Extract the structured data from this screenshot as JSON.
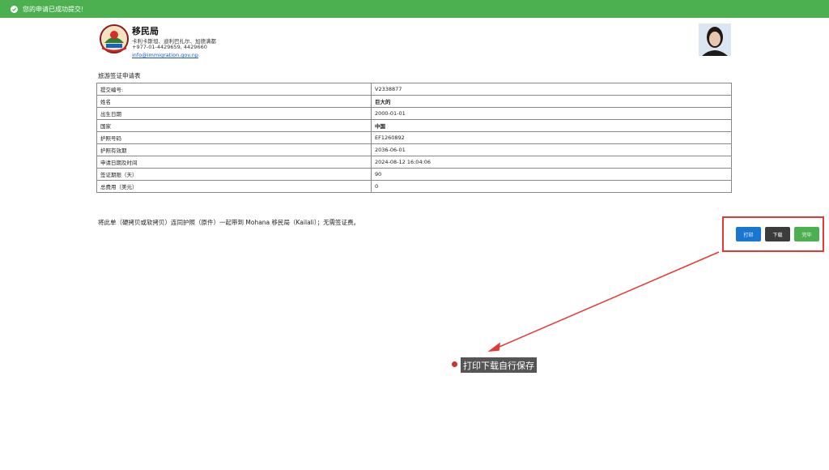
{
  "banner": {
    "message": "您的申请已成功提交!"
  },
  "office": {
    "name": "移民局",
    "address": "卡利卡斯坦、迪利巴扎尔、加德满都",
    "phone": "+977-01-4429659, 4429660",
    "email": "info@immigration.gov.np"
  },
  "form": {
    "title": "旅游签证申请表",
    "rows": [
      {
        "label": "提交编号:",
        "value": "V2338877"
      },
      {
        "label": "姓名",
        "value": "巨大的"
      },
      {
        "label": "出生日期",
        "value": "2000-01-01"
      },
      {
        "label": "国家",
        "value": "中国"
      },
      {
        "label": "护照号码",
        "value": "EF1260892"
      },
      {
        "label": "护照有效期",
        "value": "2036-06-01"
      },
      {
        "label": "申请日期及时间",
        "value": "2024-08-12 16:04:06"
      },
      {
        "label": "签证期限（天）",
        "value": "90"
      },
      {
        "label": "总费用（美元）",
        "value": "0"
      }
    ]
  },
  "note": "将此单（硬拷贝或软拷贝）连同护照（原件）一起带到 Mohana 移民局（Kailali）；无需签证费。",
  "buttons": {
    "print": "打印",
    "download": "下载",
    "done": "完毕"
  },
  "annotation": {
    "text": "打印下载自行保存",
    "color": "#e53935"
  },
  "colors": {
    "banner": "#4caf50",
    "print": "#1976d2",
    "download": "#3c3c3c",
    "done": "#4caf50"
  }
}
